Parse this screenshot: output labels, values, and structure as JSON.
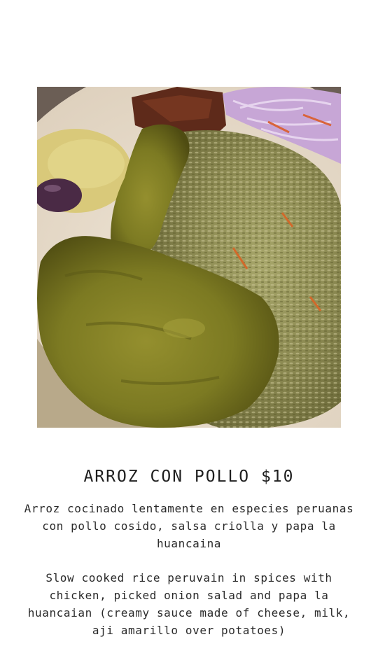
{
  "menu_item": {
    "photo": {
      "subject": "chicken-leg-with-green-rice",
      "palette": {
        "plate": "#e8dccb",
        "rice": "#8c8a52",
        "chicken": "#7c7a22",
        "onion": "#c7a6d6",
        "sauce": "#d9c97a",
        "olive": "#4a2a45",
        "pork": "#5e2a1a"
      }
    },
    "title": "ARROZ CON POLLO $10",
    "description_es": "Arroz cocinado lentamente en especies peruanas con pollo cosido, salsa criolla y papa la huancaina",
    "description_en": "Slow cooked rice peruvain in spices with chicken, picked onion salad and papa la huancaian (creamy sauce made of cheese, milk, aji amarillo over potatoes)"
  }
}
